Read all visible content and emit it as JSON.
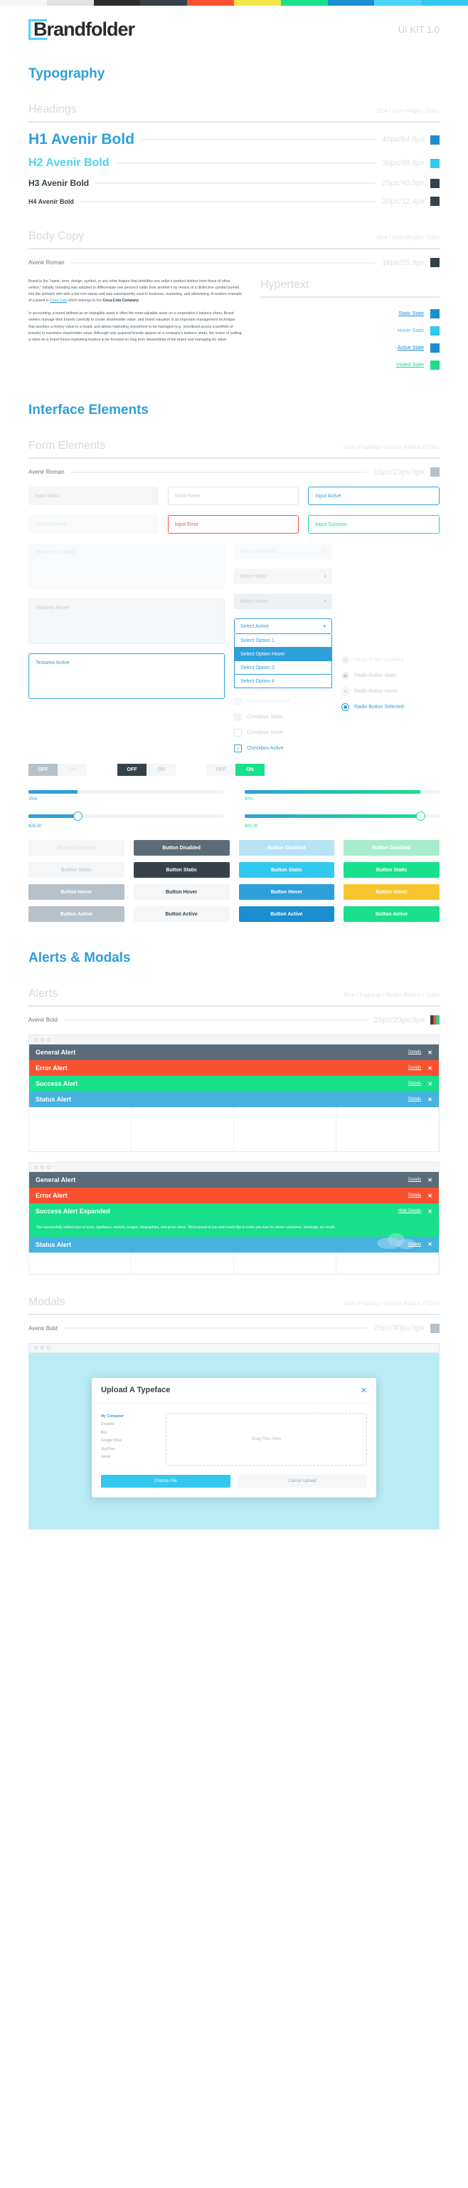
{
  "palette": [
    "#f4f6f8",
    "#dfe3e6",
    "#2b2b2b",
    "#36424a",
    "#f9512f",
    "#f4e74a",
    "#18e08b",
    "#1b8ed0",
    "#4dd3f7",
    "#32c8f0"
  ],
  "brand": {
    "name": "Brandfolder",
    "version": "UI KIT 1.0"
  },
  "typography": {
    "section_title": "Typography",
    "headings": {
      "title": "Headings",
      "spec_legend": "Size / Line-Height / Color",
      "rows": [
        {
          "label": "H1 Avenir Bold",
          "value": "40px/64.8px",
          "color": "#1b8ed0"
        },
        {
          "label": "H2 Avenir Bold",
          "value": "30px/48.6px",
          "color": "#32c8f0"
        },
        {
          "label": "H3 Avenir Bold",
          "value": "25px/40.5px",
          "color": "#36424a"
        },
        {
          "label": "H4 Avenir Bold",
          "value": "20px/32.4px",
          "color": "#36424a"
        }
      ]
    },
    "body": {
      "title": "Body Copy",
      "spec_legend": "Size / Line-Height / Color",
      "font_label": "Avenir Roman",
      "font_value": "16px/25.9px",
      "font_color": "#36424a",
      "p1_a": "Brand is the \"name, term, design, symbol, or any other feature that identifies one seller's product distinct from those of other sellers.\" Initially, branding was adopted to differentiate one person's cattle from another's by means of a distinctive symbol burned into the animal's skin with a hot iron stamp and was subsequently used in business, marketing, and advertising. A modern example of a brand is ",
      "p1_link": "Coca Cola",
      "p1_b": " which belongs to the ",
      "p1_bold": "Coca-Cola Company",
      "p1_c": ".",
      "p2": "In accounting, a brand defined as an intangible asset is often the most valuable asset on a corporation's balance sheet. Brand owners manage their brands carefully to create shareholder value, and brand valuation is an important management technique that ascribes a money value to a brand, and allows marketing investment to be managed (e.g.: prioritized across a portfolio of brands) to maximize shareholder value. Although only acquired brands appear on a company's balance sheet, the notion of putting a value on a brand forces marketing leaders to be focused on long term stewardship of the brand and managing for value."
    },
    "hypertext": {
      "title": "Hypertext",
      "rows": [
        {
          "label": "Static State",
          "color": "#1b8ed0"
        },
        {
          "label": "Hover State",
          "color": "#32c8f0"
        },
        {
          "label": "Active State",
          "color": "#1b8ed0"
        },
        {
          "label": "Visited State",
          "color": "#18e08b"
        }
      ]
    }
  },
  "interface": {
    "section_title": "Interface Elements",
    "form": {
      "title": "Form Elements",
      "spec_legend": "Size / Padding / Border-Radius / Color",
      "font_label": "Avenir Roman",
      "font_value": "18px/20px/3px",
      "font_color": "#b6c1c9",
      "inputs": {
        "static": "Input Static",
        "hover": "Input Hover",
        "active": "Input Active",
        "disabled": "Input Disabled",
        "error": "Input Error",
        "success": "Input Success"
      },
      "textareas": {
        "disabled": "Textarea Disabled",
        "hover": "Textarea Hover",
        "active": "Textarea Active"
      },
      "selects": {
        "disabled": "Select Disabled",
        "static": "Select Static",
        "hover": "Select Hover",
        "active": "Select Active",
        "options": [
          "Select Option 1",
          "Select Option Hover",
          "Select Option 3",
          "Select Option 4"
        ]
      },
      "checkboxes": [
        {
          "label": "Checkbox Disabled",
          "state": "disabled"
        },
        {
          "label": "Checkbox Static",
          "state": "static"
        },
        {
          "label": "Checkbox Hover",
          "state": "hover"
        },
        {
          "label": "Checkbox Active",
          "state": "active"
        }
      ],
      "radios": [
        {
          "label": "Radio Button Disabled",
          "state": "disabled"
        },
        {
          "label": "Radio Button Static",
          "state": "static"
        },
        {
          "label": "Radio Button Hover",
          "state": "hover"
        },
        {
          "label": "Radio Button Selected",
          "state": "selected"
        }
      ],
      "toggles": [
        {
          "off": "OFF",
          "on": "ON",
          "state": "disabled"
        },
        {
          "off": "OFF",
          "on": "ON",
          "state": "off"
        },
        {
          "off": "OFF",
          "on": "ON",
          "state": "on"
        }
      ],
      "progress": [
        {
          "pct": 25,
          "label": "25%",
          "color": "#2e9fd8"
        },
        {
          "pct": 90,
          "label": "90%",
          "color": "#18e08b"
        }
      ],
      "sliders": [
        {
          "pct": 25,
          "label": "$25.00",
          "color": "#2e9fd8"
        },
        {
          "pct": 90,
          "label": "$60.00",
          "color": "#18e08b"
        }
      ],
      "buttons": [
        [
          {
            "label": "Button Disabled",
            "style": "gray-disabled"
          },
          {
            "label": "Button Disabled",
            "style": "dark-disabled"
          },
          {
            "label": "Button Disabled",
            "style": "blue-disabled"
          },
          {
            "label": "Button Disabled",
            "style": "green-disabled"
          }
        ],
        [
          {
            "label": "Button Static",
            "style": "gray-static"
          },
          {
            "label": "Button Static",
            "style": "dark-static"
          },
          {
            "label": "Button Static",
            "style": "blue-static"
          },
          {
            "label": "Button Static",
            "style": "green-static"
          }
        ],
        [
          {
            "label": "Button Hover",
            "style": "gray-hover"
          },
          {
            "label": "Button Hover",
            "style": "dark-hover"
          },
          {
            "label": "Button Hover",
            "style": "blue-hover"
          },
          {
            "label": "Button Hover",
            "style": "green-hover"
          }
        ],
        [
          {
            "label": "Button Active",
            "style": "gray-active"
          },
          {
            "label": "Button Active",
            "style": "dark-active"
          },
          {
            "label": "Button Active",
            "style": "blue-active"
          },
          {
            "label": "Button Active",
            "style": "green-active"
          }
        ]
      ]
    }
  },
  "alerts": {
    "section_title": "Alerts & Modals",
    "title": "Alerts",
    "spec_legend": "Size / Padding / Stroke-Radius / Color",
    "font_label": "Avenir Bold",
    "font_value": "25px/20px/3px",
    "details_label": "Details",
    "hide_details_label": "Hide Details",
    "close_label": "✕",
    "set1": [
      {
        "label": "General Alert",
        "color": "#5b6b77"
      },
      {
        "label": "Error Alert",
        "color": "#f9512f"
      },
      {
        "label": "Success Alert",
        "color": "#18e08b"
      },
      {
        "label": "Status Alert",
        "color": "#47b2e0"
      }
    ],
    "set2": [
      {
        "label": "General Alert",
        "color": "#5b6b77"
      },
      {
        "label": "Error Alert",
        "color": "#f9512f"
      },
      {
        "label": "Success Alert Expanded",
        "color": "#18e08b"
      },
      {
        "label": "Status Alert",
        "color": "#47b2e0"
      }
    ],
    "expanded_text": "You successfully added tons of icons, typefaces, vectors, images, biographies, and press items. We're proud of you and would like to invite you over for dinner sometime. Seriously, we would."
  },
  "modals": {
    "title": "Modals",
    "spec_legend": "Size / Padding / Border-Radius / Color",
    "font_label": "Avenir Bold",
    "font_value": "25px/40px/3px",
    "modal_title": "Upload A Typeface",
    "close": "✕",
    "sources_head": "My Computer",
    "sources": [
      "Dropbox",
      "Box",
      "Google Drive",
      "SkyDrive",
      "Gmail"
    ],
    "drop_text": "Drag Files Here",
    "primary_btn": "Choose File",
    "secondary_btn": "Cancel Upload"
  }
}
